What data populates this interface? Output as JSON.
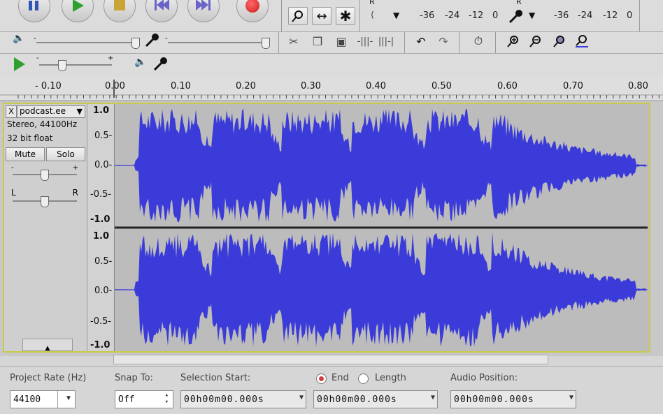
{
  "toolbar": {
    "meter_scale_record": [
      "-36",
      "-24",
      "-12",
      "0"
    ],
    "meter_scale_play": [
      "-36",
      "-24",
      "-12",
      "0"
    ],
    "meter_rec_channel": "R",
    "meter_play_channel": "R"
  },
  "ruler": {
    "ticks": [
      "- 0.10",
      "0.00",
      "0.10",
      "0.20",
      "0.30",
      "0.40",
      "0.50",
      "0.60",
      "0.70",
      "0.80"
    ]
  },
  "track": {
    "close_glyph": "X",
    "name": "podcast.ee",
    "menu_glyph": "▼",
    "format": "Stereo, 44100Hz",
    "bit_depth": "32 bit float",
    "mute_label": "Mute",
    "solo_label": "Solo",
    "pan_left": "L",
    "pan_right": "R",
    "gain_minus": "-",
    "gain_plus": "+",
    "scale_labels": [
      "1.0",
      "0.5-",
      "0.0-",
      "-0.5-",
      "-1.0"
    ],
    "scale_labels_2": [
      "1.0",
      "0.5-",
      "0.0-",
      "-0.5-",
      "-1.0"
    ],
    "waveform_color": "#3b3bd9"
  },
  "status": {
    "project_rate_label": "Project Rate (Hz)",
    "project_rate_value": "44100",
    "snap_label": "Snap To:",
    "snap_value": "Off",
    "selection_start_label": "Selection Start:",
    "selection_start_value": "00h00m00.000s",
    "end_label": "End",
    "length_label": "Length",
    "end_value": "00h00m00.000s",
    "audio_position_label": "Audio Position:",
    "audio_position_value": "00h00m00.000s"
  }
}
